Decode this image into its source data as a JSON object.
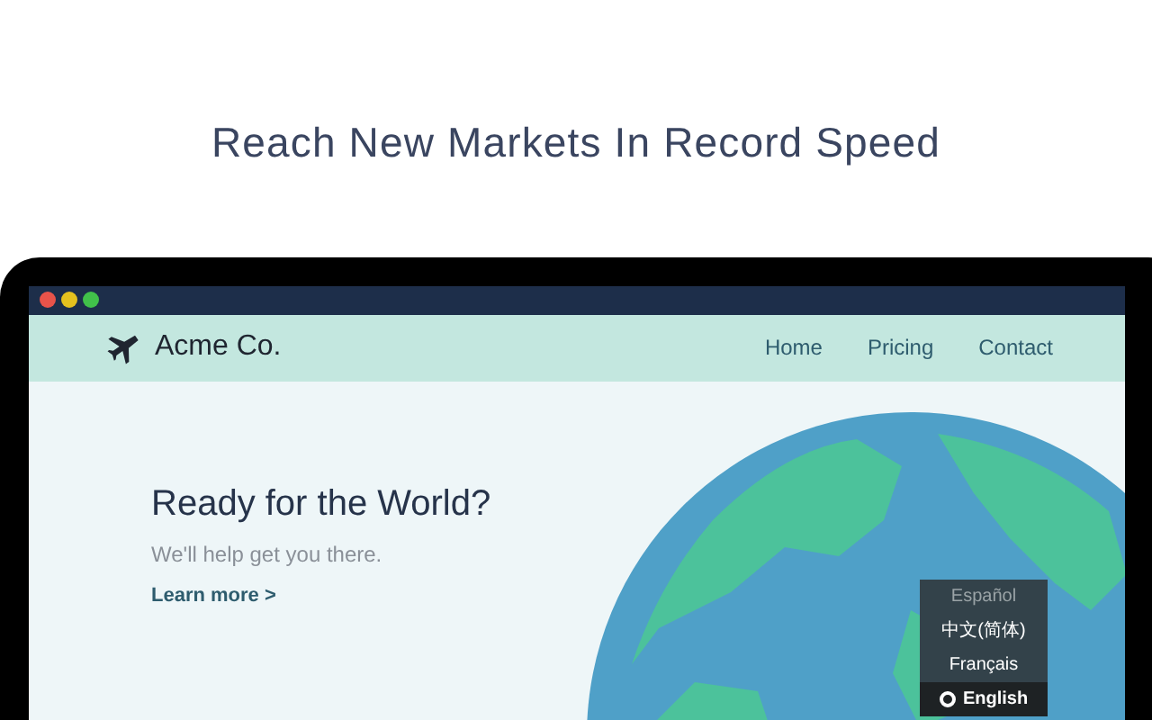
{
  "headline": "Reach New Markets In Record Speed",
  "site": {
    "brand": "Acme Co.",
    "nav": [
      {
        "label": "Home"
      },
      {
        "label": "Pricing"
      },
      {
        "label": "Contact"
      }
    ]
  },
  "hero": {
    "title": "Ready for the World?",
    "subtitle": "We'll help get you there.",
    "link": "Learn more >"
  },
  "languages": [
    {
      "label": "Español",
      "selected": false,
      "dim": true
    },
    {
      "label": "中文(简体)",
      "selected": false,
      "dim": false
    },
    {
      "label": "Français",
      "selected": false,
      "dim": false
    },
    {
      "label": "English",
      "selected": true,
      "dim": false
    }
  ]
}
